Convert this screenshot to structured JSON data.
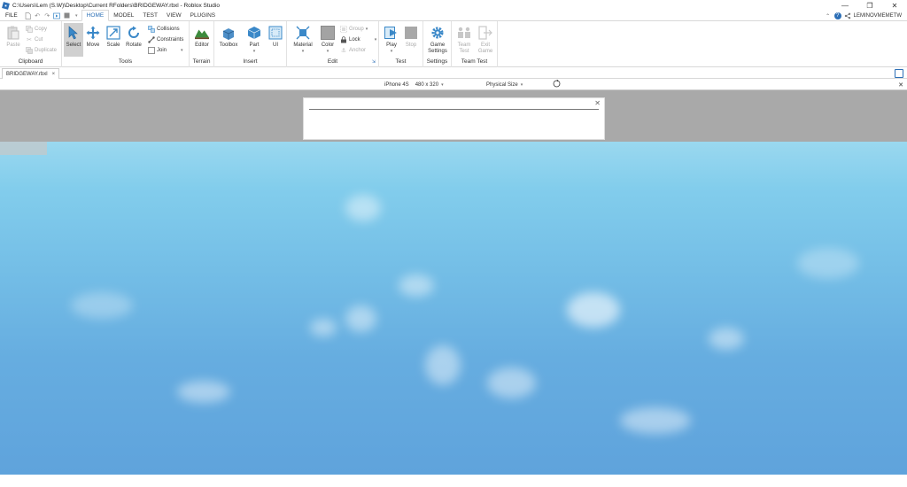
{
  "title_bar": {
    "title": "C:\\Users\\Lem (S.W)\\Desktop\\Current RFolders\\BRIDGEWAY.rbxl - Roblox Studio",
    "minimize": "—",
    "maximize": "❐",
    "close": "✕"
  },
  "menu": {
    "file": "FILE",
    "tabs": [
      "HOME",
      "MODEL",
      "TEST",
      "VIEW",
      "PLUGINS"
    ],
    "active_tab": "HOME",
    "username": "LEMINOVMEMETW"
  },
  "ribbon": {
    "clipboard": {
      "label": "Clipboard",
      "paste": "Paste",
      "copy": "Copy",
      "cut": "Cut",
      "duplicate": "Duplicate"
    },
    "tools": {
      "label": "Tools",
      "select": "Select",
      "move": "Move",
      "scale": "Scale",
      "rotate": "Rotate",
      "collisions": "Collisions",
      "constraints": "Constraints",
      "join": "Join"
    },
    "terrain": {
      "label": "Terrain",
      "editor": "Editor"
    },
    "insert": {
      "label": "Insert",
      "toolbox": "Toolbox",
      "part": "Part",
      "ui": "UI"
    },
    "edit": {
      "label": "Edit",
      "material": "Material",
      "color": "Color",
      "group": "Group",
      "lock": "Lock",
      "anchor": "Anchor"
    },
    "test": {
      "label": "Test",
      "play": "Play",
      "stop": "Stop"
    },
    "settings": {
      "label": "Settings",
      "game_settings_1": "Game",
      "game_settings_2": "Settings"
    },
    "team_test": {
      "label": "Team Test",
      "team_1": "Team",
      "team_2": "Test",
      "exit_1": "Exit",
      "exit_2": "Game"
    }
  },
  "document": {
    "tab_name": "BRIDGEWAY.rbxl",
    "tab_close": "×"
  },
  "device_bar": {
    "device": "iPhone 4S",
    "resolution": "480 x 320",
    "size_mode": "Physical Size",
    "close": "✕"
  },
  "dialog": {
    "close": "✕"
  },
  "colors": {
    "accent": "#2d6fb6",
    "sky_top": "#9ad8ef",
    "sky_bottom": "#5fa3dc",
    "viewport_gray": "#a9a9a9"
  }
}
